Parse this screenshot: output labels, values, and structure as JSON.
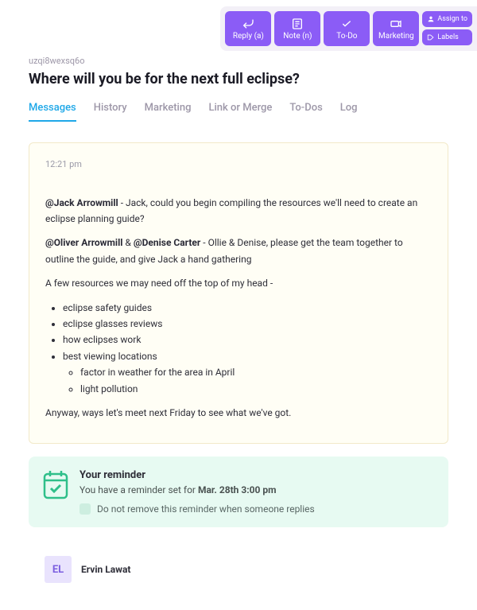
{
  "toolbar": {
    "reply": "Reply (a)",
    "note": "Note (n)",
    "todo": "To-Do",
    "marketing": "Marketing",
    "assign": "Assign to",
    "labels": "Labels"
  },
  "ticket": {
    "id": "uzqi8wexsq6o",
    "title": "Where will you be for the next full eclipse?"
  },
  "tabs": [
    "Messages",
    "History",
    "Marketing",
    "Link or Merge",
    "To-Dos",
    "Log"
  ],
  "message": {
    "time": "12:21 pm",
    "mentions": {
      "jack": "@Jack Arrowmill",
      "oliver": "@Oliver Arrowmill",
      "denise": "@Denise Carter"
    },
    "line_jack": " - Jack, could you begin compiling the resources we'll need to create an eclipse planning guide?",
    "amp": " & ",
    "line_team": " - Ollie & Denise, please get the team together to outline the guide, and give Jack a hand gathering",
    "intro": "A few resources we may need off the top of my head -",
    "items": {
      "i0": "eclipse safety guides",
      "i1": "eclipse glasses reviews",
      "i2": "how eclipses work",
      "i3": "best viewing locations",
      "s0": "factor in weather for the area in April",
      "s1": "light pollution"
    },
    "outro": "Anyway, ways let's meet next Friday to see what we've got."
  },
  "reminder": {
    "title": "Your reminder",
    "prefix": "You have a reminder set for ",
    "date": "Mar. 28th 3:00 pm",
    "keep": "Do not remove this reminder when someone replies"
  },
  "reply": {
    "initials": "EL",
    "name": "Ervin Lawat"
  }
}
